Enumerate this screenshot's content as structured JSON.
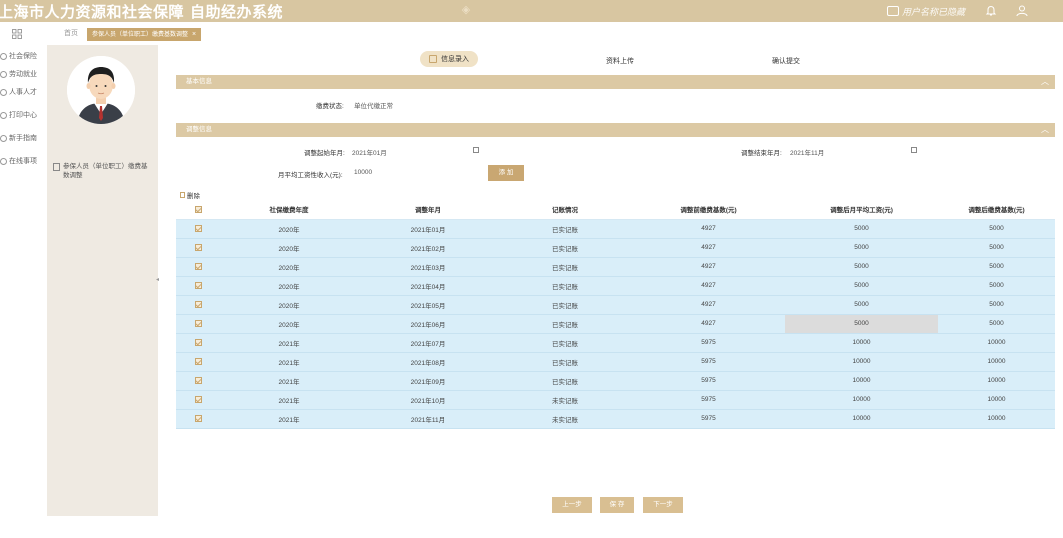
{
  "header": {
    "title": "上海市人力资源和社会保障",
    "subtitle": "自助经办系统",
    "user_label": "用户名称已隐藏",
    "icons": [
      "monitor-icon",
      "bell-icon",
      "person-icon"
    ]
  },
  "tabs": {
    "home": "首页",
    "active": "参保人员（单位职工）缴费基数调整",
    "close_symbol": "×"
  },
  "nav": {
    "items": [
      "社会保险",
      "劳动就业",
      "人事人才",
      "打印中心",
      "新手指南",
      "在线事项"
    ]
  },
  "profile": {
    "item_label": "参保人员（单位职工）缴费基数调整"
  },
  "steps": {
    "items": [
      "信息录入",
      "资料上传",
      "确认提交"
    ]
  },
  "sections": {
    "basic_title": "基本信息",
    "adjust_title": "调整信息"
  },
  "basic": {
    "status_label": "缴费状态:",
    "status_value": "单位代缴正常"
  },
  "adjust": {
    "start_label": "调整起始年月:",
    "start_value": "2021年01月",
    "end_label": "调整结束年月:",
    "end_value": "2021年11月",
    "income_label": "月平均工资性收入(元):",
    "income_value": "10000",
    "add_button": "添 加",
    "delete_label": "删除"
  },
  "table": {
    "headers": [
      "社保缴费年度",
      "调整年月",
      "记账情况",
      "调整前缴费基数(元)",
      "调整后月平均工资(元)",
      "调整后缴费基数(元)"
    ],
    "rows": [
      [
        "2020年",
        "2021年01月",
        "已实记账",
        "4927",
        "5000",
        "5000"
      ],
      [
        "2020年",
        "2021年02月",
        "已实记账",
        "4927",
        "5000",
        "5000"
      ],
      [
        "2020年",
        "2021年03月",
        "已实记账",
        "4927",
        "5000",
        "5000"
      ],
      [
        "2020年",
        "2021年04月",
        "已实记账",
        "4927",
        "5000",
        "5000"
      ],
      [
        "2020年",
        "2021年05月",
        "已实记账",
        "4927",
        "5000",
        "5000"
      ],
      [
        "2020年",
        "2021年06月",
        "已实记账",
        "4927",
        "5000",
        "5000"
      ],
      [
        "2021年",
        "2021年07月",
        "已实记账",
        "5975",
        "10000",
        "10000"
      ],
      [
        "2021年",
        "2021年08月",
        "已实记账",
        "5975",
        "10000",
        "10000"
      ],
      [
        "2021年",
        "2021年09月",
        "已实记账",
        "5975",
        "10000",
        "10000"
      ],
      [
        "2021年",
        "2021年10月",
        "未实记账",
        "5975",
        "10000",
        "10000"
      ],
      [
        "2021年",
        "2021年11月",
        "未实记账",
        "5975",
        "10000",
        "10000"
      ]
    ],
    "highlighted_row": 5
  },
  "buttons": {
    "prev": "上一步",
    "save": "保 存",
    "next": "下一步"
  },
  "colors": {
    "header_bg": "#d8c6a1",
    "accent": "#c8a66d",
    "row_bg": "#d9eef9"
  }
}
